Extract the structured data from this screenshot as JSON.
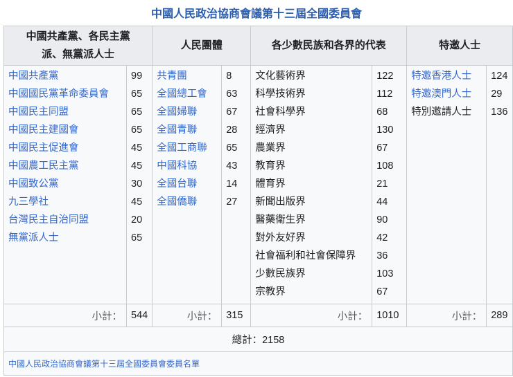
{
  "title": "中國人民政治協商會議第十三屆全國委員會",
  "headers": [
    "中國共產黨、各民主黨派、無黨派人士",
    "人民團體",
    "各少數民族和各界的代表",
    "特邀人士"
  ],
  "groups": [
    {
      "items": [
        {
          "name": "中國共產黨",
          "count": "99",
          "link": true
        },
        {
          "name": "中國國民黨革命委員會",
          "count": "65",
          "link": true
        },
        {
          "name": "中國民主同盟",
          "count": "65",
          "link": true
        },
        {
          "name": "中國民主建國會",
          "count": "65",
          "link": true
        },
        {
          "name": "中國民主促進會",
          "count": "45",
          "link": true
        },
        {
          "name": "中國農工民主黨",
          "count": "45",
          "link": true
        },
        {
          "name": "中國致公黨",
          "count": "30",
          "link": true
        },
        {
          "name": "九三學社",
          "count": "45",
          "link": true
        },
        {
          "name": "台灣民主自治同盟",
          "count": "20",
          "link": true
        },
        {
          "name": "無黨派人士",
          "count": "65",
          "link": true
        }
      ],
      "subtotal": "544"
    },
    {
      "items": [
        {
          "name": "共青團",
          "count": "8",
          "link": true
        },
        {
          "name": "全國總工會",
          "count": "63",
          "link": true
        },
        {
          "name": "全國婦聯",
          "count": "67",
          "link": true
        },
        {
          "name": "全國青聯",
          "count": "28",
          "link": true
        },
        {
          "name": "全國工商聯",
          "count": "65",
          "link": true
        },
        {
          "name": "中國科協",
          "count": "43",
          "link": true
        },
        {
          "name": "全國台聯",
          "count": "14",
          "link": true
        },
        {
          "name": "全國僑聯",
          "count": "27",
          "link": true
        }
      ],
      "subtotal": "315"
    },
    {
      "items": [
        {
          "name": "文化藝術界",
          "count": "122",
          "link": false
        },
        {
          "name": "科學技術界",
          "count": "112",
          "link": false
        },
        {
          "name": "社會科學界",
          "count": "68",
          "link": false
        },
        {
          "name": "經濟界",
          "count": "130",
          "link": false
        },
        {
          "name": "農業界",
          "count": "67",
          "link": false
        },
        {
          "name": "教育界",
          "count": "108",
          "link": false
        },
        {
          "name": "體育界",
          "count": "21",
          "link": false
        },
        {
          "name": "新聞出版界",
          "count": "44",
          "link": false
        },
        {
          "name": "醫藥衛生界",
          "count": "90",
          "link": false
        },
        {
          "name": "對外友好界",
          "count": "42",
          "link": false
        },
        {
          "name": "社會福利和社會保障界",
          "count": "36",
          "link": false
        },
        {
          "name": "少數民族界",
          "count": "103",
          "link": false
        },
        {
          "name": "宗教界",
          "count": "67",
          "link": false
        }
      ],
      "subtotal": "1010"
    },
    {
      "items": [
        {
          "name": "特邀香港人士",
          "count": "124",
          "link": true
        },
        {
          "name": "特邀澳門人士",
          "count": "29",
          "link": true
        },
        {
          "name": "特別邀請人士",
          "count": "136",
          "link": false
        }
      ],
      "subtotal": "289"
    }
  ],
  "subtotal_label": "小計：",
  "total": "總計：2158",
  "footer_link": "中國人民政治協商會議第十三屆全國委員會委員名單",
  "colors": {
    "link": "#3366cc",
    "header_bg": "#eaecf0",
    "title": "#2a5db0"
  }
}
